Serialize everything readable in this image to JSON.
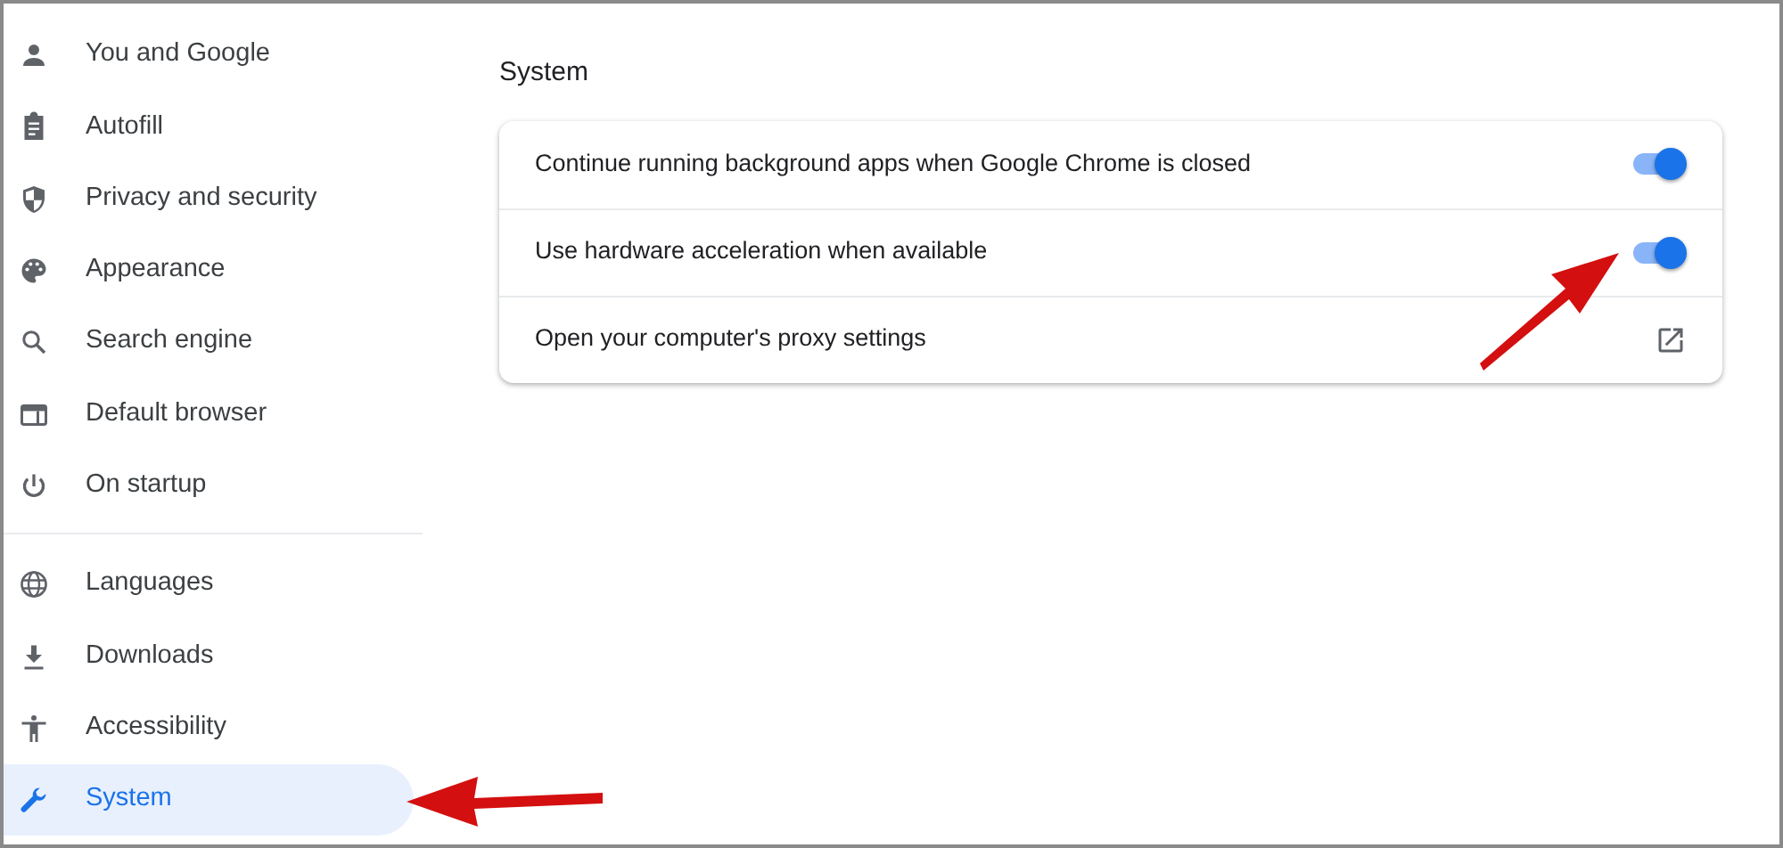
{
  "sidebar": {
    "groups": [
      {
        "items": [
          {
            "label": "You and Google",
            "selected": false
          },
          {
            "label": "Autofill",
            "selected": false
          },
          {
            "label": "Privacy and security",
            "selected": false
          },
          {
            "label": "Appearance",
            "selected": false
          },
          {
            "label": "Search engine",
            "selected": false
          },
          {
            "label": "Default browser",
            "selected": false
          },
          {
            "label": "On startup",
            "selected": false
          }
        ]
      },
      {
        "items": [
          {
            "label": "Languages",
            "selected": false
          },
          {
            "label": "Downloads",
            "selected": false
          },
          {
            "label": "Accessibility",
            "selected": false
          },
          {
            "label": "System",
            "selected": true
          }
        ]
      }
    ]
  },
  "section": {
    "title": "System",
    "rows": [
      {
        "kind": "toggle",
        "label": "Continue running background apps when Google Chrome is closed",
        "on": true
      },
      {
        "kind": "toggle",
        "label": "Use hardware acceleration when available",
        "on": true
      },
      {
        "kind": "link",
        "label": "Open your computer's proxy settings"
      }
    ]
  }
}
